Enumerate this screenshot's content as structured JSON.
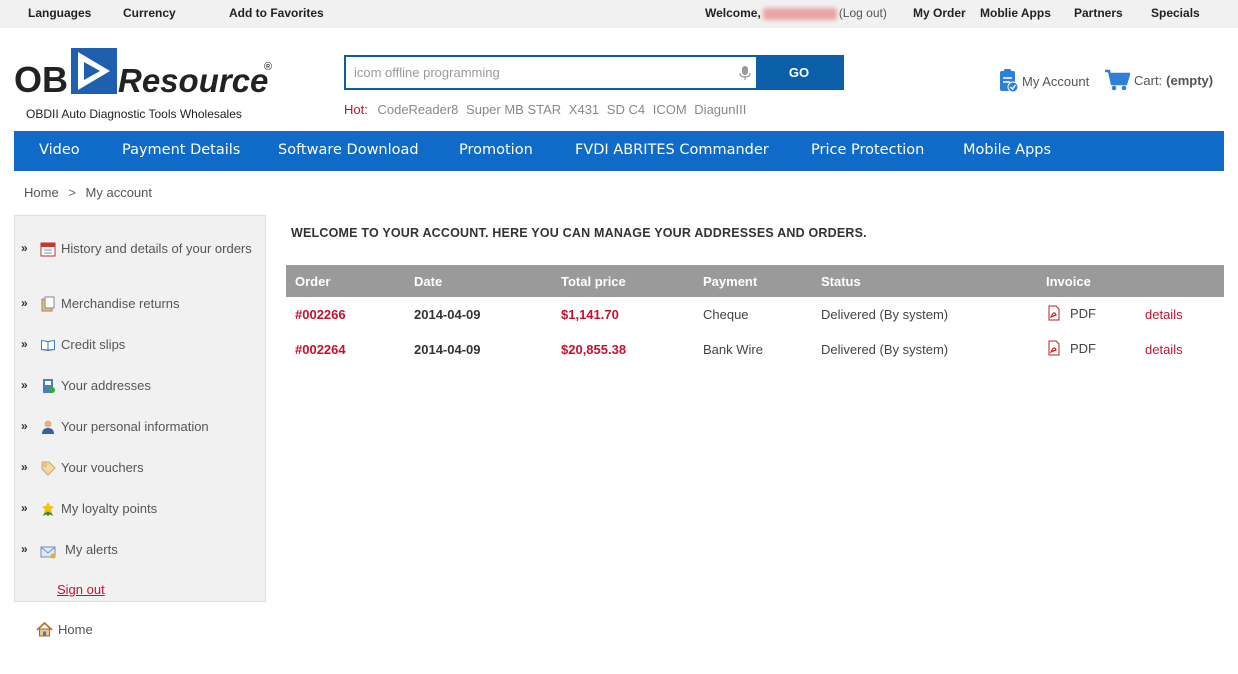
{
  "topbar": {
    "languages": "Languages",
    "currency": "Currency",
    "favorites": "Add to Favorites",
    "welcome": "Welcome,",
    "logout": "(Log out)",
    "my_order": "My Order",
    "mobile_apps": "Moblie Apps",
    "partners": "Partners",
    "specials": "Specials"
  },
  "logo": {
    "brand_left": "OB",
    "brand_right": "Resource",
    "registered": "®",
    "tagline": "OBDII Auto Diagnostic Tools Wholesales"
  },
  "search": {
    "placeholder": "icom offline programming",
    "button": "GO"
  },
  "hot": {
    "label": "Hot:",
    "items": [
      "CodeReader8",
      "Super MB STAR",
      "X431",
      "SD C4",
      "ICOM",
      "DiagunIII"
    ]
  },
  "account": {
    "label": "My Account"
  },
  "cart": {
    "label": "Cart:",
    "status": "(empty)"
  },
  "nav": [
    "Video",
    "Payment Details",
    "Software Download",
    "Promotion",
    "FVDI ABRITES Commander",
    "Price Protection",
    "Mobile Apps"
  ],
  "breadcrumb": {
    "home": "Home",
    "sep": ">",
    "current": "My account"
  },
  "sidebar": {
    "items": [
      {
        "label": "History and details of your orders",
        "icon": "calendar-icon"
      },
      {
        "label": "Merchandise returns",
        "icon": "clipboard-icon"
      },
      {
        "label": "Credit slips",
        "icon": "book-icon"
      },
      {
        "label": "Your addresses",
        "icon": "address-book-icon"
      },
      {
        "label": "Your personal information",
        "icon": "user-icon"
      },
      {
        "label": "Your vouchers",
        "icon": "tag-icon"
      },
      {
        "label": "My loyalty points",
        "icon": "medal-icon"
      },
      {
        "label": "My alerts",
        "icon": "mail-icon"
      }
    ],
    "signout": "Sign out"
  },
  "footer_home": "Home",
  "main": {
    "welcome": "WELCOME TO YOUR ACCOUNT. HERE YOU CAN MANAGE YOUR ADDRESSES AND ORDERS.",
    "columns": [
      "Order",
      "Date",
      "Total price",
      "Payment",
      "Status",
      "Invoice",
      ""
    ],
    "orders": [
      {
        "order": "#002266",
        "date": "2014-04-09",
        "total": "$1,141.70",
        "payment": "Cheque",
        "status": "Delivered (By system)",
        "invoice": "PDF",
        "details": "details"
      },
      {
        "order": "#002264",
        "date": "2014-04-09",
        "total": "$20,855.38",
        "payment": "Bank Wire",
        "status": "Delivered (By system)",
        "invoice": "PDF",
        "details": "details"
      }
    ]
  },
  "colors": {
    "brand_blue": "#0f6ac8",
    "accent_red": "#c8102e",
    "table_header": "#9a9a9a"
  }
}
